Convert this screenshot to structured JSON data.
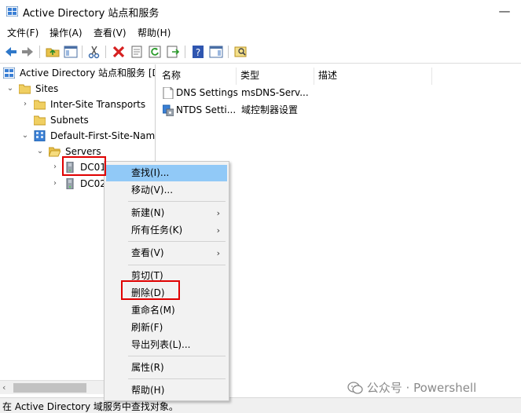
{
  "window": {
    "title": "Active Directory 站点和服务",
    "minimize_glyph": "—"
  },
  "menu": [
    "文件(F)",
    "操作(A)",
    "查看(V)",
    "帮助(H)"
  ],
  "tree": {
    "root": "Active Directory 站点和服务 [D",
    "sites": "Sites",
    "inter_site_transports": "Inter-Site Transports",
    "subnets": "Subnets",
    "default_site": "Default-First-Site-Nam",
    "servers": "Servers",
    "dc01": "DC01",
    "dc02": "DC02"
  },
  "list": {
    "columns": [
      "名称",
      "类型",
      "描述"
    ],
    "rows": [
      {
        "name": "DNS Settings",
        "type": "msDNS-Serv..."
      },
      {
        "name": "NTDS Setti...",
        "type": "域控制器设置"
      }
    ]
  },
  "context_menu": {
    "find": "查找(I)...",
    "move": "移动(V)...",
    "new": "新建(N)",
    "all_tasks": "所有任务(K)",
    "view": "查看(V)",
    "cut": "剪切(T)",
    "delete": "删除(D)",
    "rename": "重命名(M)",
    "refresh": "刷新(F)",
    "export": "导出列表(L)...",
    "properties": "属性(R)",
    "help": "帮助(H)",
    "submenu_arrow": "›"
  },
  "status": {
    "text": "在 Active Directory 域服务中查找对象。",
    "watermark": "公众号 · Powershell"
  },
  "colors": {
    "highlight": "#91c9f7",
    "annotation_red": "#e00000"
  }
}
